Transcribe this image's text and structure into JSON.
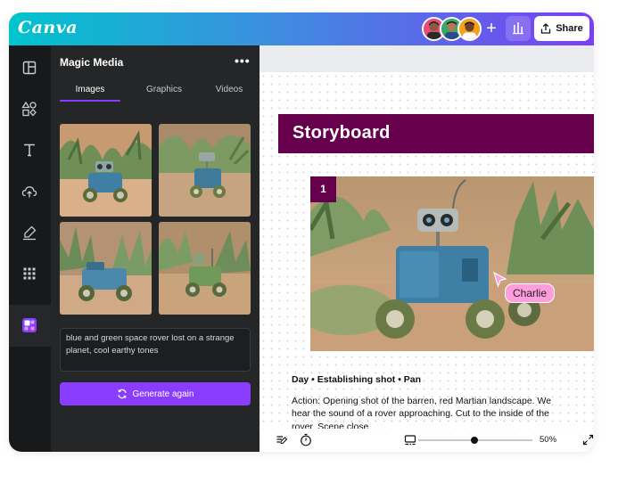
{
  "header": {
    "logo": "Canva",
    "share_label": "Share",
    "add_label": "+"
  },
  "panel": {
    "title": "Magic Media",
    "more_label": "•••",
    "tabs": [
      {
        "label": "Images",
        "active": true
      },
      {
        "label": "Graphics",
        "active": false
      },
      {
        "label": "Videos",
        "active": false
      }
    ],
    "prompt": "blue and green space rover lost on a strange planet, cool earthy tones",
    "generate_label": "Generate again"
  },
  "rail": {
    "icons": [
      "layout-icon",
      "elements-icon",
      "text-icon",
      "upload-icon",
      "draw-icon",
      "apps-icon",
      "magic-media-icon"
    ]
  },
  "canvas": {
    "title": "Storyboard",
    "scene_number": "1",
    "cursor_label": "Charlie",
    "scene_heading": "Day • Establishing shot • Pan",
    "scene_description": "Action: Opening shot of the barren, red Martian landscape. We hear the sound of a rover approaching. Cut to the inside of the rover. Scene close.",
    "zoom_label": "50%",
    "zoom_level": 0.5
  },
  "colors": {
    "brand_gradient_start": "#00c4cc",
    "brand_gradient_end": "#7b3ff2",
    "accent_purple": "#8b3dff",
    "storyboard_plum": "#66004d",
    "cursor_pink": "#ff9ddd"
  }
}
